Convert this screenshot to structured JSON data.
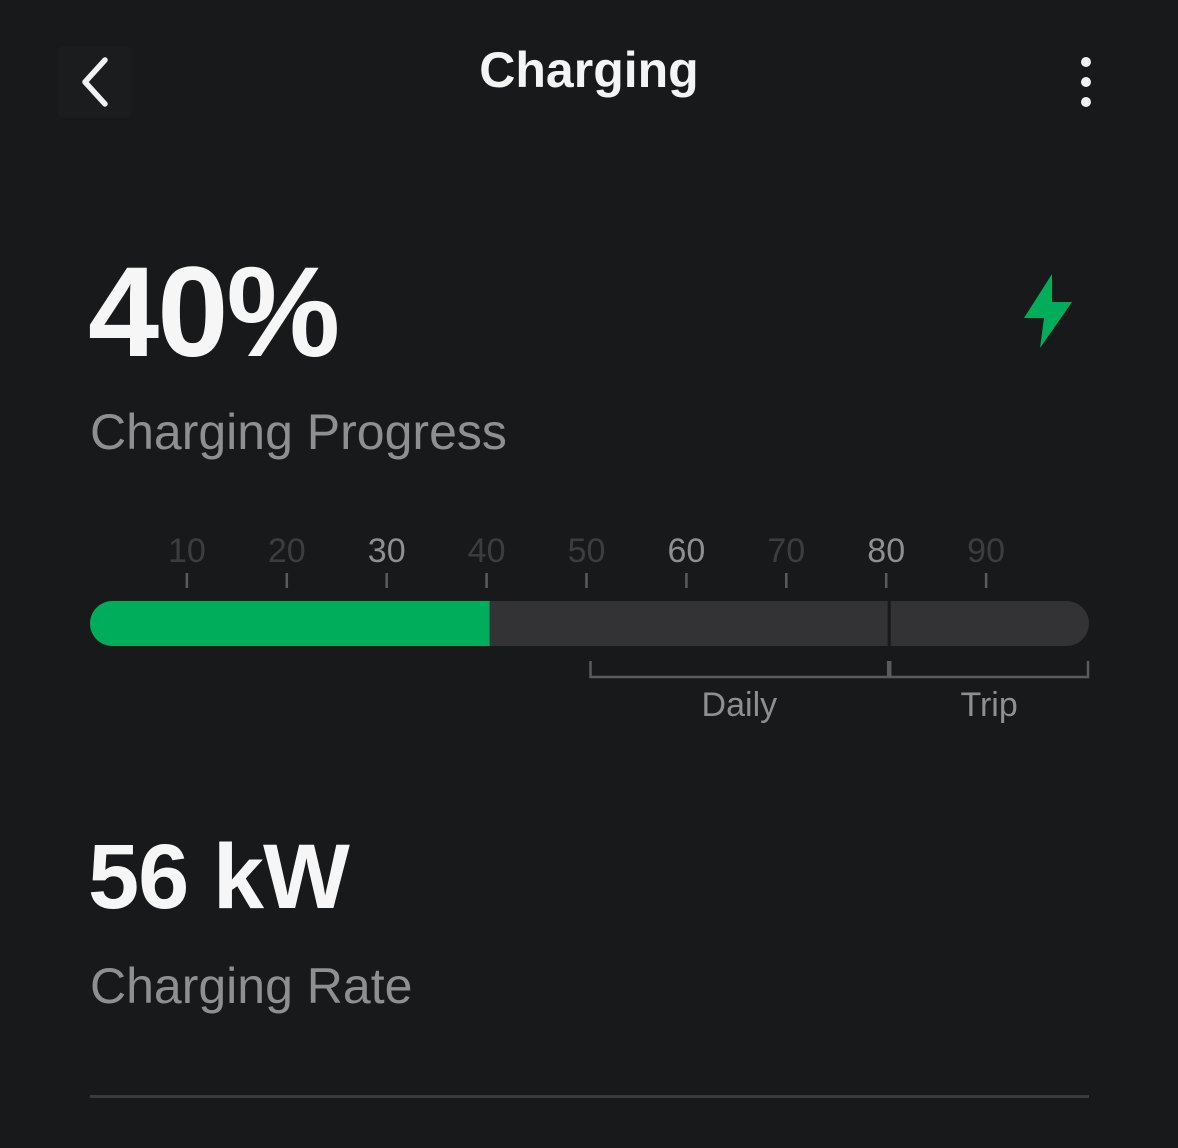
{
  "header": {
    "title": "Charging"
  },
  "charge": {
    "percent_label": "40%",
    "progress_label": "Charging Progress",
    "level": 0.4,
    "limit_marker": 0.8,
    "rate_value": "56 kW",
    "rate_label": "Charging Rate"
  },
  "gauge": {
    "ticks": [
      "10",
      "20",
      "30",
      "40",
      "50",
      "60",
      "70",
      "80",
      "90"
    ],
    "highlighted_ticks": [
      "30",
      "60",
      "80"
    ],
    "ranges": [
      {
        "label": "Daily",
        "from": 50,
        "to": 80
      },
      {
        "label": "Trip",
        "from": 80,
        "to": 100
      }
    ]
  },
  "colors": {
    "background": "#18191b",
    "accent": "#00ad5b",
    "track": "#333335",
    "muted_text": "#8f8f8f",
    "faded_text": "#3c3d40"
  },
  "icons": {
    "back": "chevron-left-icon",
    "more": "vertical-ellipsis-icon",
    "status": "lightning-bolt-icon"
  }
}
